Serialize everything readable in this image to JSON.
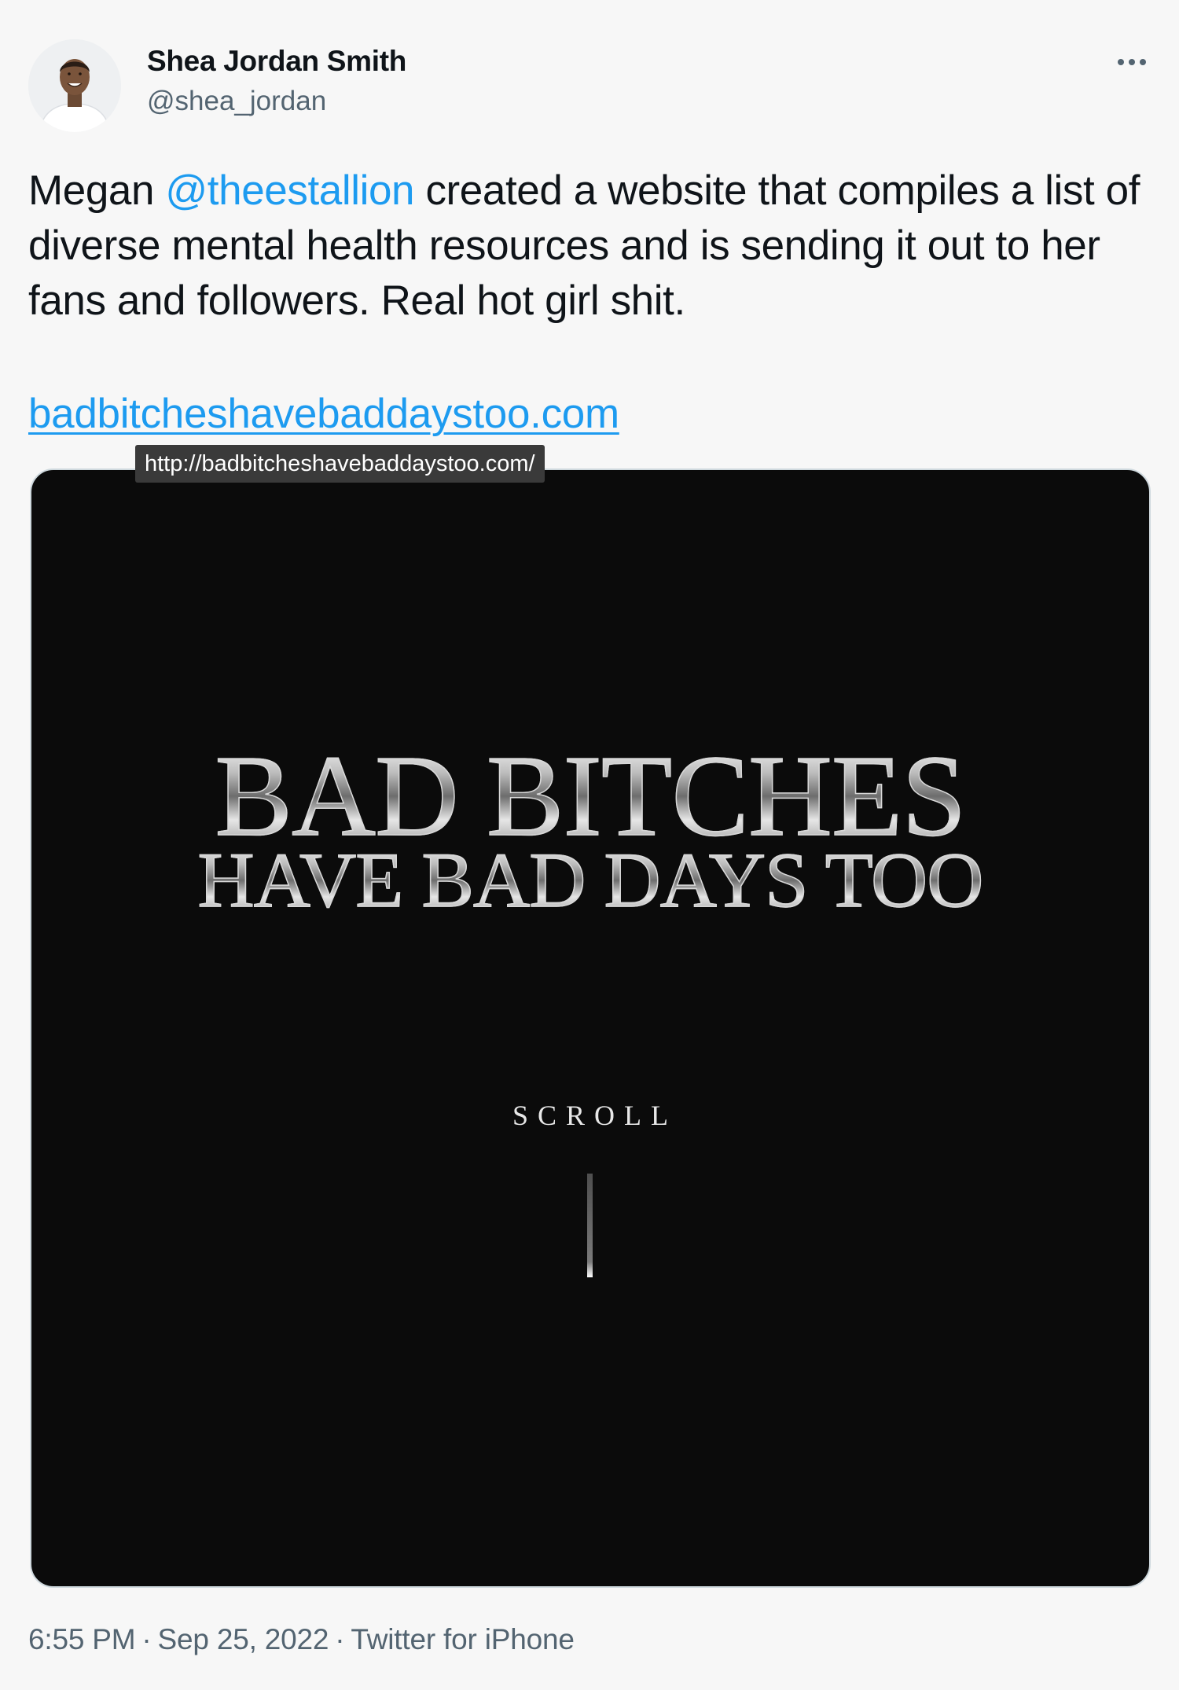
{
  "author": {
    "name": "Shea Jordan Smith",
    "handle": "@shea_jordan"
  },
  "tweet": {
    "text_before": "Megan ",
    "mention": "@theestallion",
    "text_after": " created a website that compiles a list of diverse mental health resources and is sending it out to her fans and followers. Real hot girl shit.",
    "link_text": "badbitcheshavebaddaystoo.com",
    "link_tooltip": "http://badbitcheshavebaddaystoo.com/"
  },
  "media": {
    "title_line1": "BAD BITCHES",
    "title_line2": "HAVE BAD DAYS TOO",
    "scroll_label": "SCROLL"
  },
  "meta": {
    "time": "6:55 PM",
    "date": "Sep 25, 2022",
    "source": "Twitter for iPhone",
    "separator": "·"
  },
  "icons": {
    "more": "more-horizontal-icon",
    "avatar": "profile-photo"
  },
  "colors": {
    "background": "#f7f7f7",
    "text": "#0f1419",
    "secondary": "#536471",
    "accent": "#1d9bf0",
    "media_bg": "#0b0b0b"
  }
}
